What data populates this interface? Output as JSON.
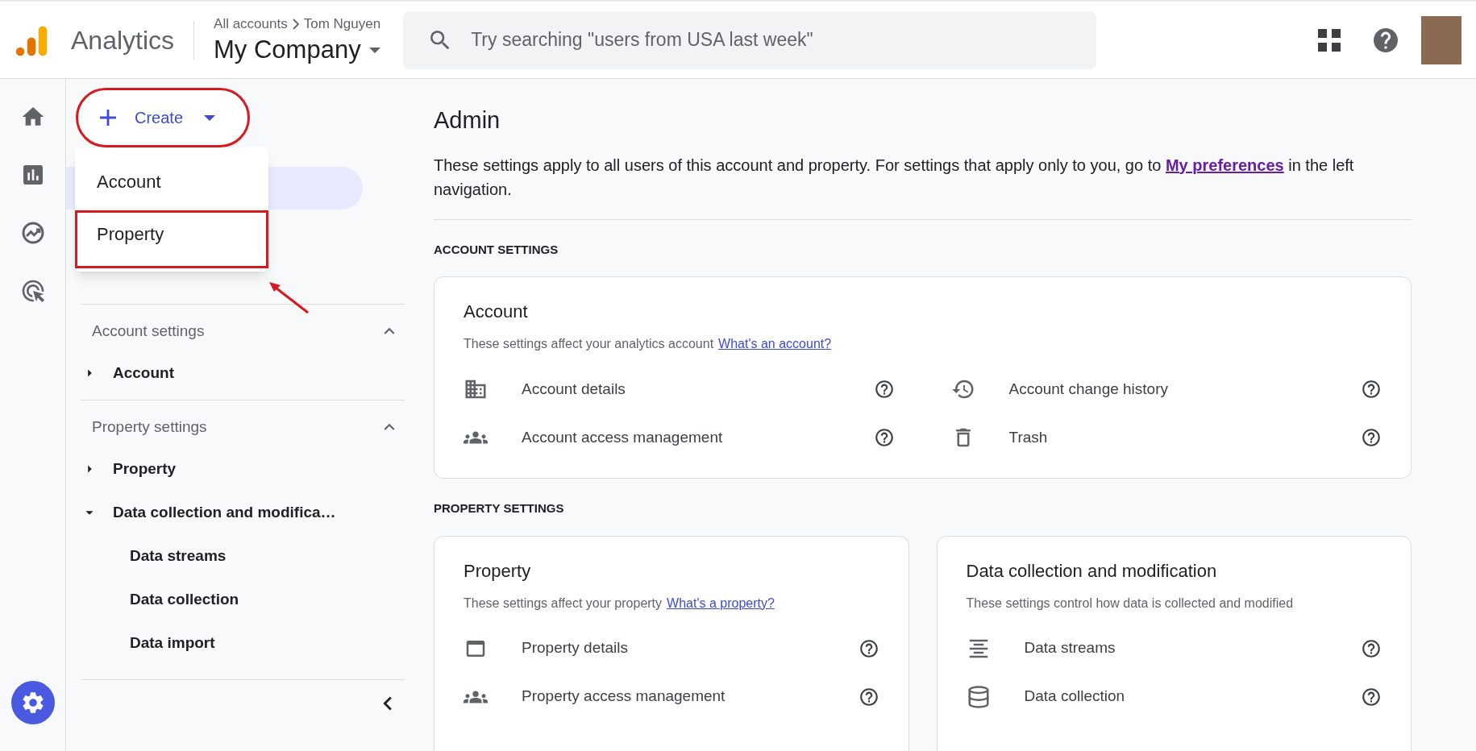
{
  "header": {
    "product": "Analytics",
    "breadcrumb": [
      "All accounts",
      "Tom Nguyen"
    ],
    "account": "My Company",
    "search": {
      "placeholder": "Try searching \"users from USA last week\""
    }
  },
  "rail": [
    {
      "kind": "home",
      "selected": false
    },
    {
      "kind": "reports",
      "selected": false
    },
    {
      "kind": "explore",
      "selected": false
    },
    {
      "kind": "advertising",
      "selected": false
    },
    {
      "kind": "admin",
      "selected": true
    }
  ],
  "create": {
    "label": "Create",
    "highlighted": true
  },
  "create_menu": [
    {
      "label": "Account",
      "highlighted": false
    },
    {
      "label": "Property",
      "highlighted": true
    }
  ],
  "nav": [
    {
      "title": "Account settings",
      "expanded": true,
      "items": [
        {
          "label": "Account",
          "expanded": false
        }
      ]
    },
    {
      "title": "Property settings",
      "expanded": true,
      "items": [
        {
          "label": "Property",
          "expanded": false
        },
        {
          "label": "Data collection and modifica…",
          "expanded": true,
          "children": [
            {
              "label": "Data streams"
            },
            {
              "label": "Data collection"
            },
            {
              "label": "Data import"
            }
          ]
        }
      ]
    }
  ],
  "main": {
    "title": "Admin",
    "intro_before": "These settings apply to all users of this account and property. For settings that apply only to you, go to",
    "intro_link": "My preferences",
    "intro_after": "in the left navigation.",
    "sections": [
      {
        "heading": "ACCOUNT SETTINGS",
        "cards": [
          {
            "title": "Account",
            "description": "These settings affect your analytics account",
            "link": "What's an account?",
            "rows": [
              {
                "label": "Account details"
              },
              {
                "label": "Account change history"
              },
              {
                "label": "Account access management"
              },
              {
                "label": "Trash"
              }
            ]
          }
        ]
      },
      {
        "heading": "PROPERTY SETTINGS",
        "cards": [
          {
            "title": "Property",
            "description": "These settings affect your property",
            "link": "What's a property?",
            "rows": [
              {
                "label": "Property details"
              },
              {
                "label": "Property access management"
              }
            ]
          },
          {
            "title": "Data collection and modification",
            "description": "These settings control how data is collected and modified",
            "rows": [
              {
                "label": "Data streams"
              },
              {
                "label": "Data collection"
              }
            ]
          }
        ]
      }
    ]
  }
}
